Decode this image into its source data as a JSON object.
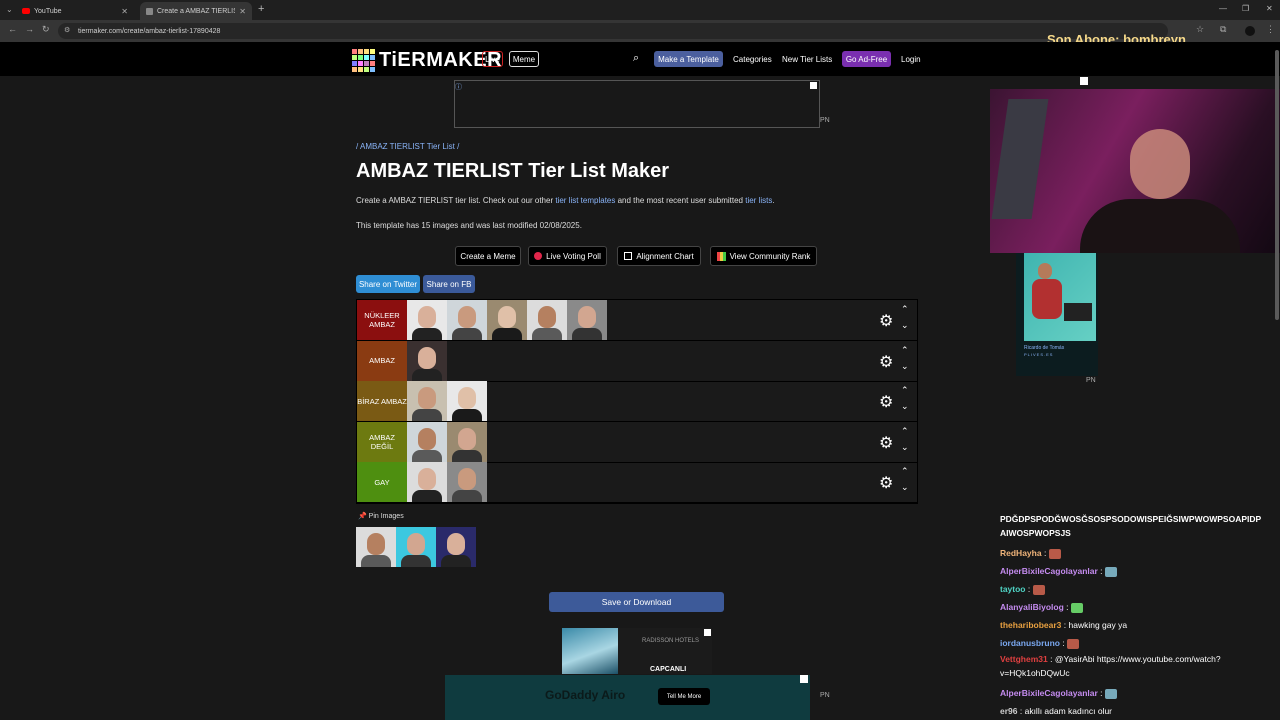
{
  "browser": {
    "tabs": [
      {
        "label": "YouTube",
        "active": false
      },
      {
        "label": "Create a AMBAZ TIERLIST Tier L",
        "active": true
      }
    ],
    "url": "tiermaker.com/create/ambaz-tierlist-17890428"
  },
  "overlay": {
    "subscriber": "Son Abone: bombreyn"
  },
  "site": {
    "logo": "TiERMAKER",
    "live": "Live",
    "meme": "Meme",
    "make_template": "Make a Template",
    "categories": "Categories",
    "new_tier_lists": "New Tier Lists",
    "ad_free": "Go Ad-Free",
    "login": "Login"
  },
  "page": {
    "breadcrumb": "/ AMBAZ TIERLIST Tier List /",
    "title": "AMBAZ TIERLIST Tier List Maker",
    "desc_pre": "Create a AMBAZ TIERLIST tier list. Check out our other ",
    "desc_link1": "tier list templates",
    "desc_mid": " and the most recent user submitted ",
    "desc_link2": "tier lists",
    "desc_post": ".",
    "meta": "This template has 15 images and was last modified 02/08/2025.",
    "buttons": {
      "create_meme": "Create a Meme",
      "live_poll": "Live Voting Poll",
      "alignment": "Alignment Chart",
      "community": "View Community Rank"
    },
    "share_twitter": "Share on Twitter",
    "share_fb": "Share on FB",
    "pin_images": "Pin Images",
    "save": "Save or Download"
  },
  "tiers": [
    {
      "label": "NÜKLEER AMBAZ",
      "color": "#8b0f0f",
      "count": 5
    },
    {
      "label": "AMBAZ",
      "color": "#8a3b12",
      "count": 1
    },
    {
      "label": "BİRAZ AMBAZ",
      "color": "#7a5a14",
      "count": 2
    },
    {
      "label": "AMBAZ DEĞİL",
      "color": "#6d7a10",
      "count": 2
    },
    {
      "label": "GAY",
      "color": "#4e8f10",
      "count": 2
    }
  ],
  "pool_count": 3,
  "ads": {
    "radisson": "RADISSON HOTELS",
    "capcanli": "CAPCANLI",
    "godaddy": "GoDaddy Airo",
    "tellme": "Tell Me More",
    "pn": "PN",
    "side_caption": "Ricardo de Tomás",
    "side_site": "PLIVES.ES"
  },
  "chat": {
    "header": "PDĞDPSPODĞWOSĞSOSPSODOWISPEIĞSIWPWOWPSOAPIDP AIWOSPWOPSJS",
    "lines": [
      {
        "user": "RedHayha",
        "color": "#f0b47a",
        "text": ""
      },
      {
        "user": "AlperBixileCagolayanlar",
        "color": "#c58cf0",
        "text": ""
      },
      {
        "user": "taytoo",
        "color": "#4fd3c4",
        "text": ""
      },
      {
        "user": "AlanyaliBiyolog",
        "color": "#c58cf0",
        "text": ""
      },
      {
        "user": "theharibobear3",
        "color": "#e8a040",
        "text": "hawking gay ya"
      },
      {
        "user": "iordanusbruno",
        "color": "#7aa8f0",
        "text": ""
      },
      {
        "user": "Vettghem31",
        "color": "#e04040",
        "text": "@YasirAbi https://www.youtube.com/watch?v=HQk1ohDQwUc"
      },
      {
        "user": "AlperBixileCagolayanlar",
        "color": "#c58cf0",
        "text": ""
      },
      {
        "user": "er96",
        "color": "#cfcfcf",
        "text": "akıllı adam kadıncı olur"
      }
    ]
  }
}
